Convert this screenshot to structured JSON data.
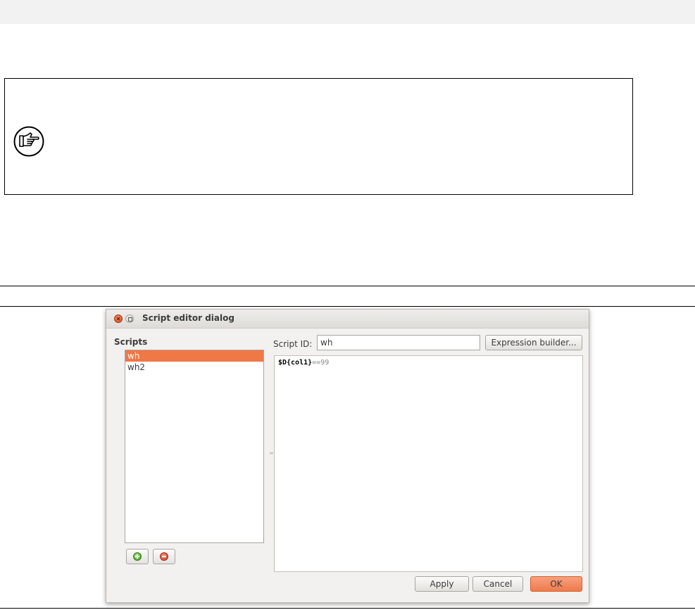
{
  "dialog": {
    "title": "Script editor dialog",
    "scripts_label": "Scripts",
    "scripts": [
      "wh",
      "wh2"
    ],
    "selected_script": "wh",
    "script_id_label": "Script ID:",
    "script_id_value": "wh",
    "expression_builder_label": "Expression builder...",
    "code_var": "$D{col1}",
    "code_rest": "==99",
    "apply_label": "Apply",
    "cancel_label": "Cancel",
    "ok_label": "OK"
  },
  "icons": {
    "note": "pointing-hand-icon",
    "add": "add-icon",
    "remove": "remove-icon",
    "close": "close-icon",
    "maximize": "maximize-icon"
  },
  "colors": {
    "accent": "#f07746",
    "dialog_bg": "#f2f1f0"
  }
}
